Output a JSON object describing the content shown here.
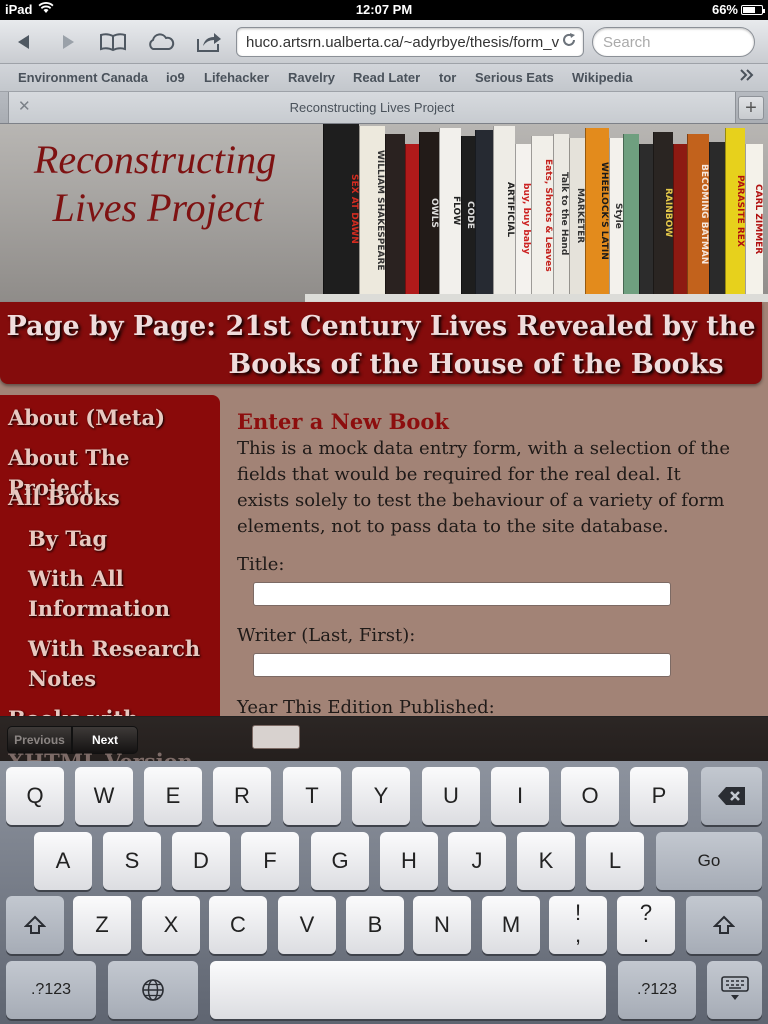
{
  "status_bar": {
    "carrier": "iPad",
    "wifi_icon": "wifi-icon",
    "time": "12:07 PM",
    "battery_text": "66%",
    "battery_level": 0.66
  },
  "toolbar": {
    "url": "huco.artsrn.ualberta.ca/~adyrbye/thesis/form_v",
    "search_placeholder": "Search"
  },
  "bookmarks": [
    "Environment Canada",
    "io9",
    "Lifehacker",
    "Ravelry",
    "Read Later",
    "tor",
    "Serious Eats",
    "Wikipedia"
  ],
  "tab": {
    "title": "Reconstructing Lives Project"
  },
  "page": {
    "site_title_line1": "Reconstructing",
    "site_title_line2": "Lives Project",
    "heading_line1": "Page by Page: 21st Century Lives Revealed by the",
    "heading_line2": "Books of the House of the Books",
    "nav": {
      "about_meta": "About (Meta)",
      "about_project": "About The Project",
      "all_books": "All Books",
      "by_tag": "By Tag",
      "with_all_1": "With All",
      "with_all_2": "Information",
      "with_research_1": "With Research",
      "with_research_2": "Notes",
      "books_with_images": "Books with Images",
      "xhtml_version": "XHTML Version"
    },
    "form": {
      "heading": "Enter a New Book",
      "intro": "This is a mock data entry form, with a selection of the fields that would be required for the real deal. It exists solely to test the behaviour of a variety of form elements, not to pass data to the site database.",
      "title_label": "Title:",
      "writer_label": "Writer (Last, First):",
      "year_label": "Year This Edition Published:"
    },
    "book_spines": [
      "SEX AT DAWN",
      "WILLIAM SHAKESPEARE",
      "OWLS",
      "FLOW",
      "CODE",
      "ARTIFICIAL",
      "buy, buy baby",
      "Eats, Shoots & Leaves",
      "Talk to the Hand",
      "MARKETER",
      "WHEELOCK'S LATIN",
      "Style",
      "RAINBOW",
      "BECOMING BATMAN",
      "PARASITE REX",
      "CARL ZIMMER"
    ]
  },
  "assistant": {
    "previous": "Previous",
    "next": "Next"
  },
  "keyboard": {
    "row1": [
      "Q",
      "W",
      "E",
      "R",
      "T",
      "Y",
      "U",
      "I",
      "O",
      "P"
    ],
    "row2": [
      "A",
      "S",
      "D",
      "F",
      "G",
      "H",
      "J",
      "K",
      "L"
    ],
    "go": "Go",
    "row3": [
      "Z",
      "X",
      "C",
      "V",
      "B",
      "N",
      "M"
    ],
    "punct1_top": "!",
    "punct1_bottom": ",",
    "punct2_top": "?",
    "punct2_bottom": ".",
    "numbers": ".?123",
    "icons": {
      "backspace": "backspace-icon",
      "shift": "shift-icon",
      "globe": "globe-icon",
      "hide": "keyboard-hide-icon"
    }
  }
}
